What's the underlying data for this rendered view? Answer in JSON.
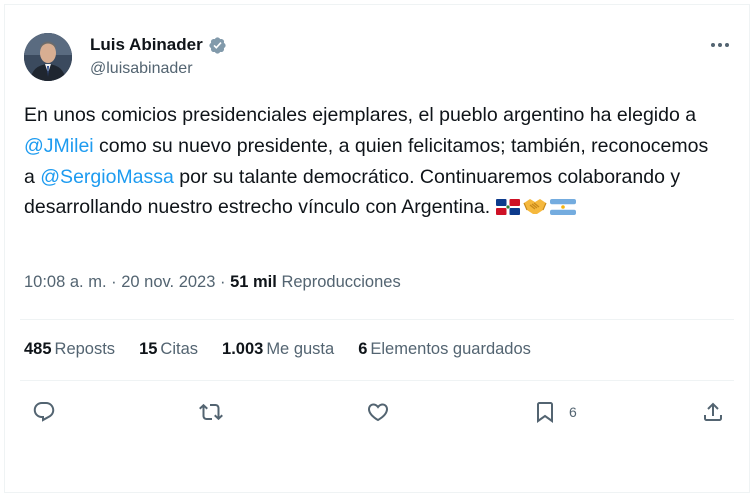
{
  "author": {
    "display_name": "Luis Abinader",
    "handle": "@luisabinader"
  },
  "tweet": {
    "text_1": "En unos comicios presidenciales ejemplares, el pueblo argentino ha elegido a ",
    "mention_1": "@JMilei",
    "text_2": " como su nuevo presidente, a quien felicitamos; también, reconocemos a ",
    "mention_2": "@SergioMassa",
    "text_3": " por su talante democrático. Continuaremos colaborando y desarrollando nuestro estrecho vínculo con Argentina. ",
    "emojis": [
      "flag-dominican-republic-icon",
      "handshake-icon",
      "flag-argentina-icon"
    ]
  },
  "meta": {
    "timestamp": "10:08 a. m. · 20 nov. 2023",
    "separator": " · ",
    "views_count": "51 mil",
    "views_label": "Reproducciones"
  },
  "stats": {
    "reposts_count": "485",
    "reposts_label": "Reposts",
    "quotes_count": "15",
    "quotes_label": "Citas",
    "likes_count": "1.003",
    "likes_label": "Me gusta",
    "bookmarks_count": "6",
    "bookmarks_label": "Elementos guardados"
  },
  "actions": {
    "reply_icon": "reply-icon",
    "repost_icon": "repost-icon",
    "like_icon": "heart-icon",
    "bookmark_icon": "bookmark-icon",
    "bookmark_count": "6",
    "share_icon": "share-icon"
  },
  "colors": {
    "accent": "#1d9bf0",
    "text": "#0f1419",
    "secondary": "#536471",
    "border": "#eff3f4"
  }
}
